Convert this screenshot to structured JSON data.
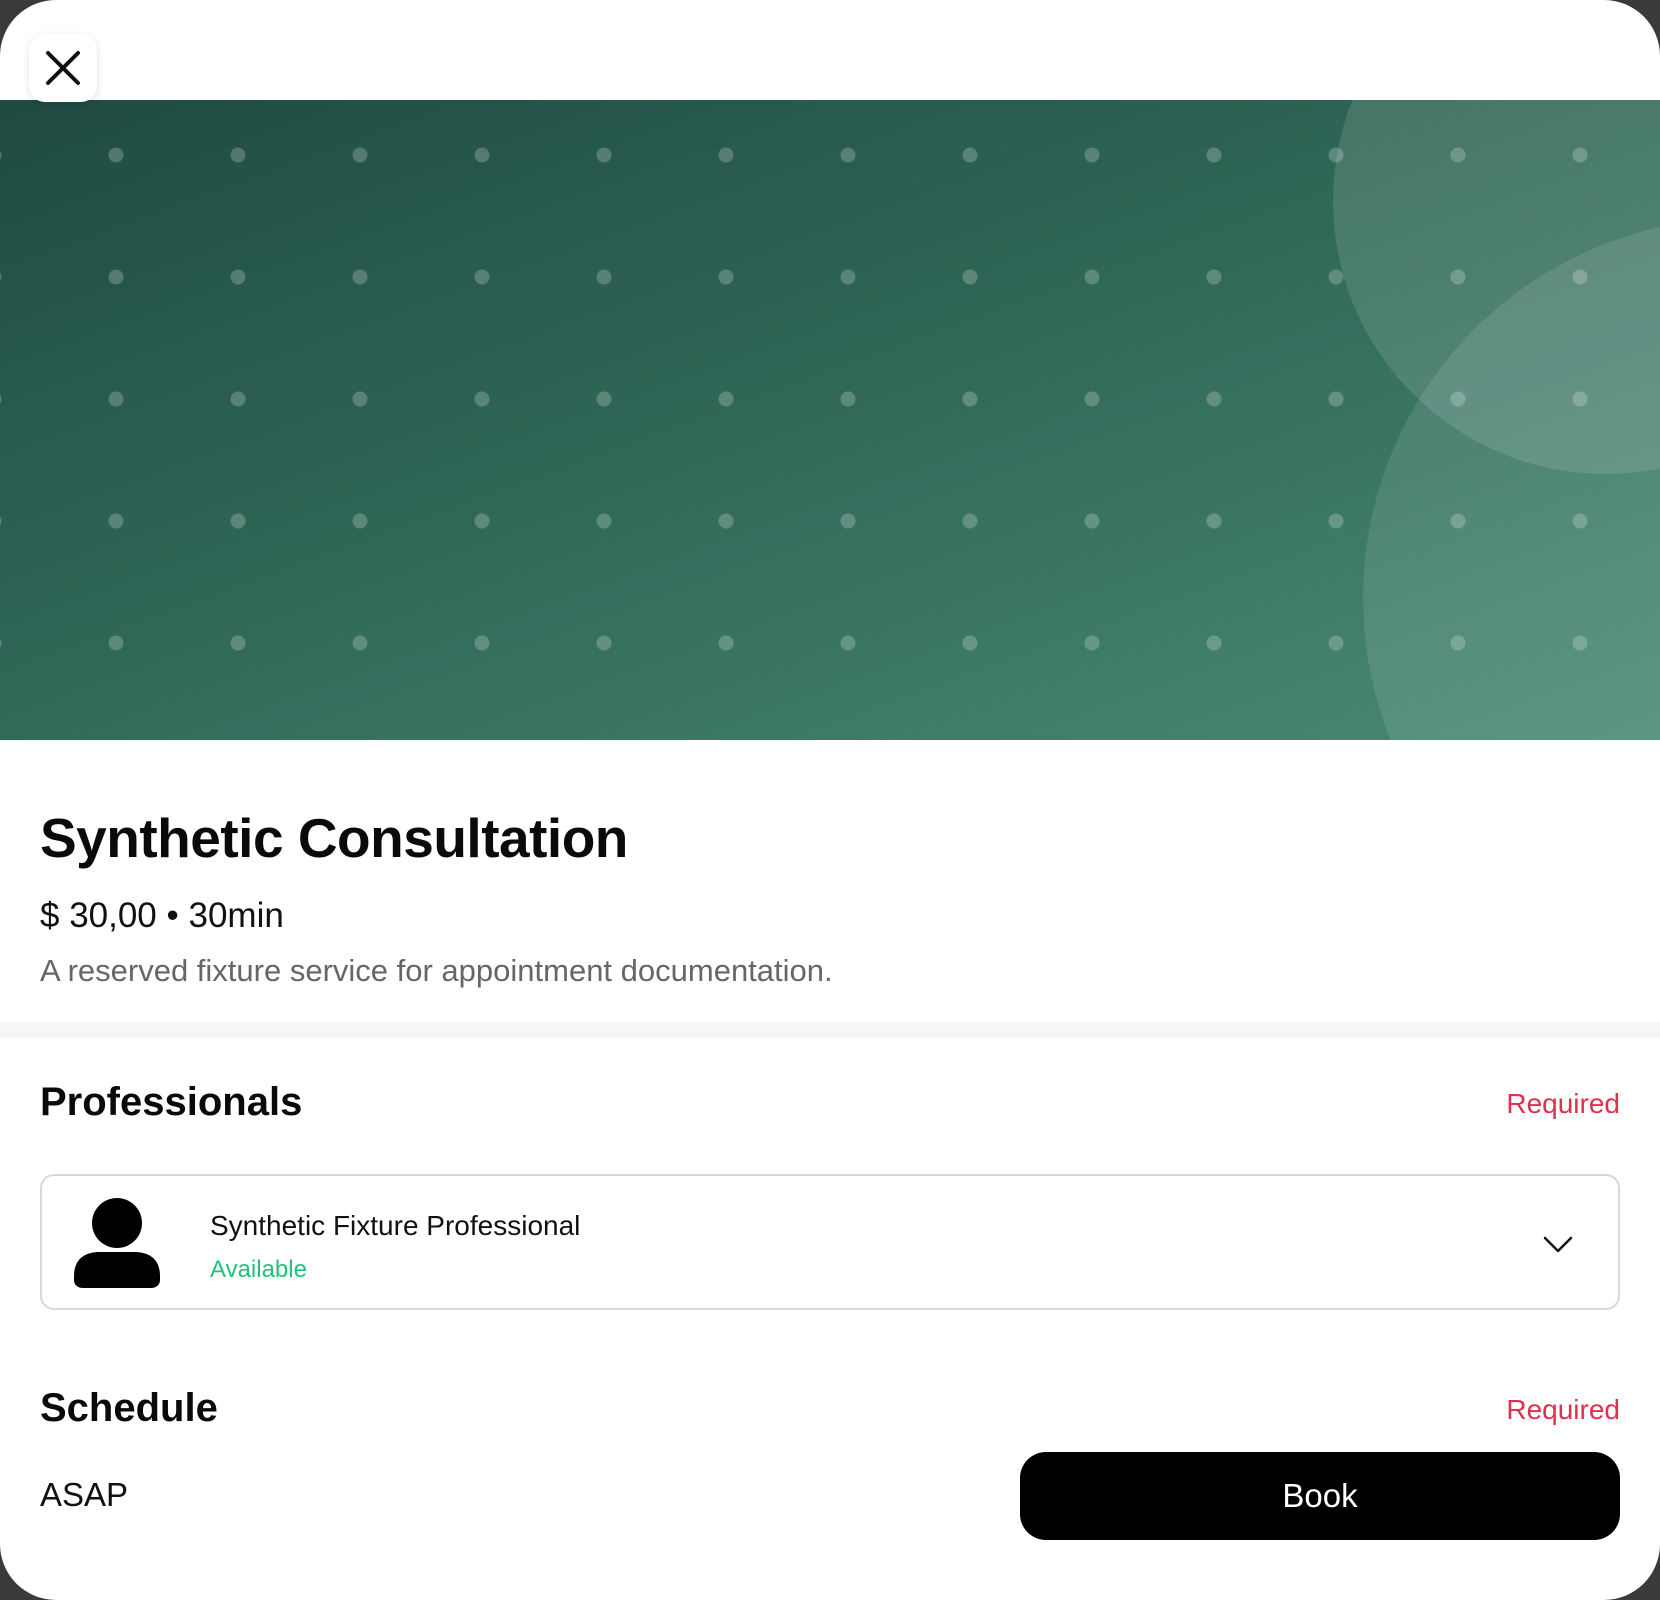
{
  "service": {
    "title": "Synthetic Consultation",
    "price_duration": "$ 30,00 • 30min",
    "description": "A reserved fixture service for appointment documentation."
  },
  "professionals": {
    "heading": "Professionals",
    "required_label": "Required",
    "selected": {
      "name": "Synthetic Fixture Professional",
      "status": "Available"
    }
  },
  "schedule": {
    "heading": "Schedule",
    "required_label": "Required",
    "value": "ASAP"
  },
  "actions": {
    "book_label": "Book"
  },
  "icons": {
    "close": "close-icon",
    "avatar": "person-icon",
    "dropdown": "chevron-down-icon"
  },
  "colors": {
    "required": "#e0304f",
    "available": "#22c27a",
    "primary_button": "#000000",
    "hero_start": "#1f4a42",
    "hero_end": "#4a8a76"
  }
}
